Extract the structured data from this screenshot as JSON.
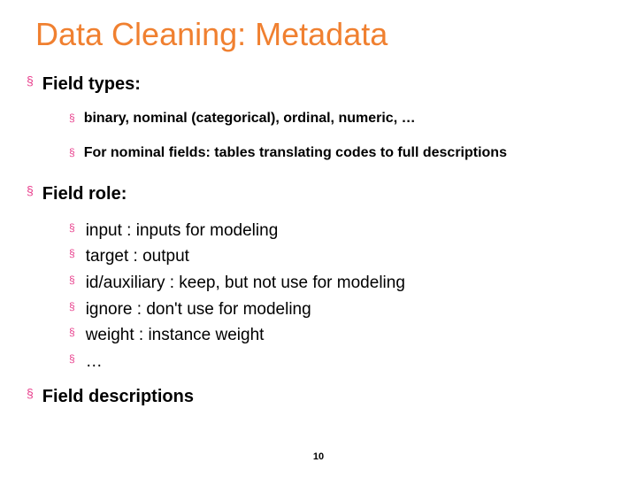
{
  "title": "Data Cleaning: Metadata",
  "sections": {
    "field_types": {
      "heading": "Field types:",
      "items": [
        "binary, nominal (categorical), ordinal, numeric, …",
        "For nominal fields: tables translating codes to full descriptions"
      ]
    },
    "field_role": {
      "heading": "Field role:",
      "items": [
        "input : inputs for modeling",
        "target : output",
        "id/auxiliary : keep, but not use for modeling",
        "ignore : don't use for modeling",
        "weight : instance weight",
        "…"
      ]
    },
    "field_descriptions": {
      "heading": "Field descriptions"
    }
  },
  "page_number": "10"
}
